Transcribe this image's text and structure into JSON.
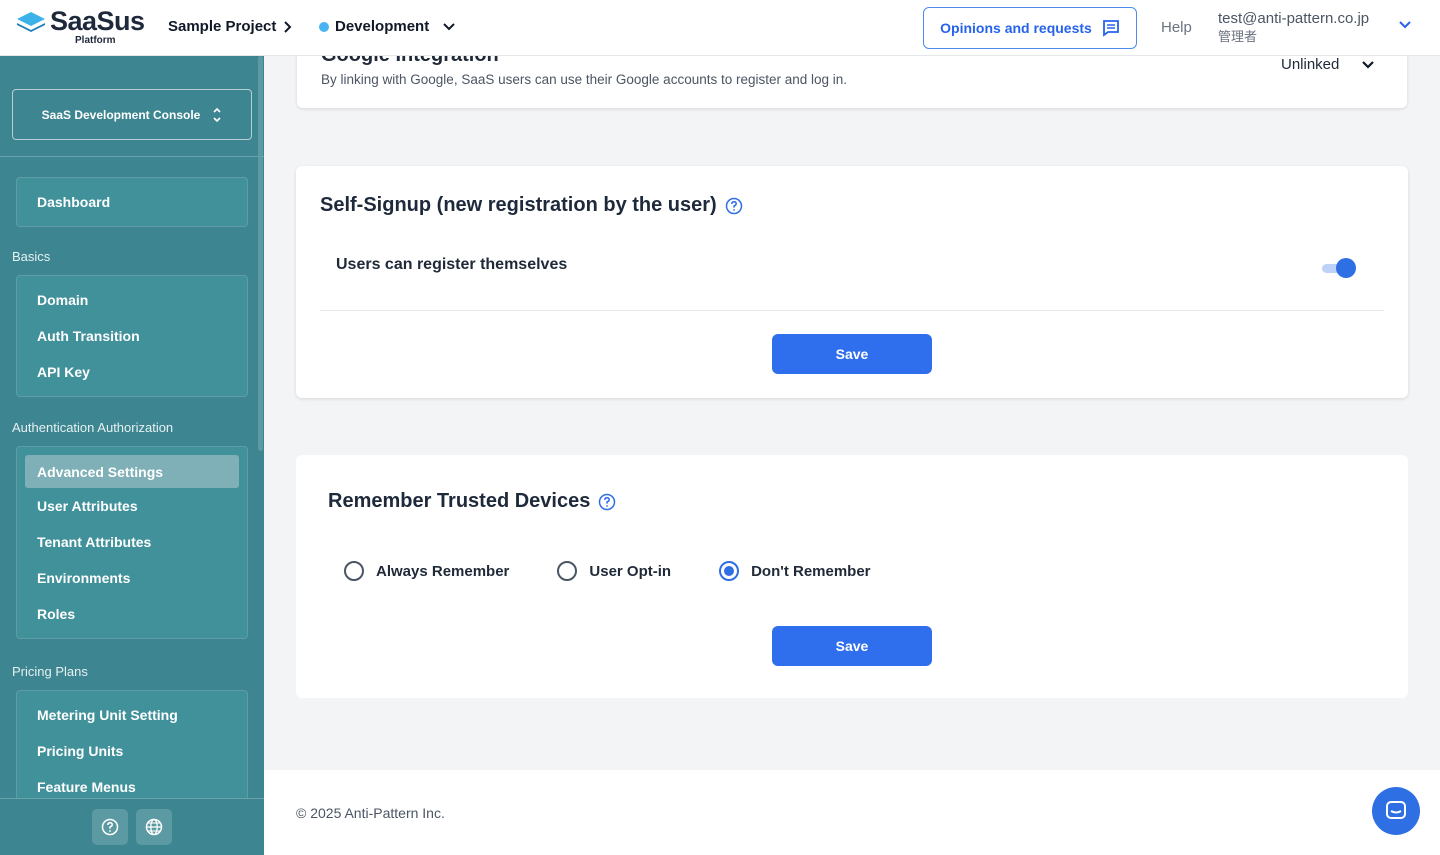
{
  "header": {
    "logo_name": "SaaSus",
    "logo_sub": "Platform",
    "project": "Sample Project",
    "environment": "Development",
    "opinions_label": "Opinions and requests",
    "help_label": "Help",
    "user_email": "test@anti-pattern.co.jp",
    "user_role": "管理者"
  },
  "sidebar": {
    "console_label": "SaaS Development Console",
    "dashboard": "Dashboard",
    "sections": [
      {
        "label": "Basics",
        "items": [
          "Domain",
          "Auth Transition",
          "API Key"
        ]
      },
      {
        "label": "Authentication Authorization",
        "items": [
          "Advanced Settings",
          "User Attributes",
          "Tenant Attributes",
          "Environments",
          "Roles"
        ]
      },
      {
        "label": "Pricing Plans",
        "items": [
          "Metering Unit Setting",
          "Pricing Units",
          "Feature Menus"
        ]
      }
    ],
    "active_item": "Advanced Settings"
  },
  "google": {
    "title": "Google Integration",
    "description": "By linking with Google, SaaS users can use their Google accounts to register and log in.",
    "status": "Unlinked"
  },
  "self_signup": {
    "title": "Self-Signup (new registration by the user)",
    "toggle_label": "Users can register themselves",
    "enabled": true,
    "save_label": "Save"
  },
  "trusted_devices": {
    "title": "Remember Trusted Devices",
    "options": [
      "Always Remember",
      "User Opt-in",
      "Don't Remember"
    ],
    "selected": "Don't Remember",
    "save_label": "Save"
  },
  "footer": {
    "copyright": "© 2025 Anti-Pattern Inc."
  },
  "colors": {
    "sidebar": "#3d8590",
    "primary": "#2f6eec",
    "env_dot": "#4ab3f4"
  }
}
